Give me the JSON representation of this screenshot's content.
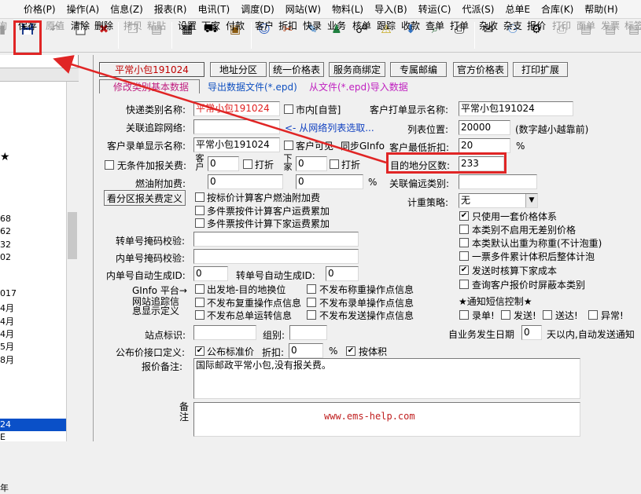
{
  "menu": [
    "价格(P)",
    "操作(A)",
    "信息(Z)",
    "报表(R)",
    "电讯(T)",
    "调度(D)",
    "网站(W)",
    "物料(L)",
    "导入(B)",
    "转运(C)",
    "代派(S)",
    "总单E",
    "合库(K)",
    "帮助(H)"
  ],
  "toolbar": {
    "left_fragment": "询",
    "save": "保存",
    "original": "原值",
    "clear": "清除",
    "delete": "删除",
    "copy": "拷贝",
    "paste": "粘贴",
    "settings": "设置",
    "download": "下家",
    "pay": "付款",
    "customer": "客户",
    "discount": "折扣",
    "express": "快录",
    "business": "业务",
    "check": "核单",
    "track": "跟踪",
    "receive": "收款",
    "query": "查单",
    "print_bill": "打单",
    "misc_receive": "杂收",
    "misc_pay": "杂支",
    "quote": "报价",
    "print": "打印",
    "face_bill": "面单",
    "invoice": "发票",
    "label": "标签"
  },
  "left_pane": {
    "fragments": [
      "★",
      "68",
      "62",
      "32",
      "02",
      "017",
      "4月",
      "4月",
      "4月",
      "5月",
      "8月",
      "24",
      "E",
      "年"
    ]
  },
  "tabs": {
    "t1": "平常小包191024",
    "t2": "地址分区",
    "t3": "统一价格表",
    "t4": "服务商绑定",
    "t5": "专属邮编",
    "t6": "官方价格表",
    "t7": "打印扩展"
  },
  "subtabs": {
    "edit": "修改类别基本数据",
    "export": "导出数据文件(*.epd)",
    "import": "从文件(*.epd)导入数据"
  },
  "form": {
    "type_name_label": "快递类别名称:",
    "type_name": "平常小包191024",
    "city_label": "市内[自营]",
    "bill_name_label": "客户打单显示名称:",
    "bill_name": "平常小包191024",
    "track_net_label": "关联追踪网络:",
    "track_hint": "<- 从网络列表选取...",
    "list_pos_label": "列表位置:",
    "list_pos": "20000",
    "list_pos_hint": "(数字越小越靠前)",
    "entry_name_label": "客户录单显示名称:",
    "entry_name": "平常小包191024",
    "cust_visible_label": "客户可见",
    "sync_label": "同步GInfo",
    "min_discount_label": "客户最低折扣:",
    "min_discount": "20",
    "pct": "%",
    "no_cond_label": "无条件加报关费:",
    "cust_v": "客户",
    "disc1": "打折",
    "val0a": "0",
    "down_v": "下家",
    "val0b": "0",
    "disc2": "打折",
    "zone_count_label": "目的地分区数:",
    "zone_count": "233",
    "fuel_label": "燃油附加费:",
    "fuel_a": "0",
    "fuel_b": "0",
    "remote_label": "关联偏远类别:",
    "view_zone_btn": "看分区报关费定义",
    "cb_fuel_std": "按标价计算客户燃油附加费",
    "cb_multi_cust": "多件票按件计算客户运费累加",
    "cb_multi_down": "多件票按件计算下家运费累加",
    "strategy_label": "计重策略:",
    "strategy": "无",
    "only_one": "只使用一套价格体系",
    "no_diff": "本类别不启用无差别价格",
    "default_weight": "本类默认出重为称重(不计泡重)",
    "multi_weight": "一票多件累计体积后整体计泡",
    "check_cost": "发送时核算下家成本",
    "hide_type": "查询客户报价时屏蔽本类别",
    "transfer_check_label": "转单号掩码校验:",
    "inner_check_label": "内单号掩码校验:",
    "inner_auto_label": "内单号自动生成ID:",
    "inner_auto": "0",
    "transfer_auto_label": "转单号自动生成ID:",
    "transfer_auto": "0",
    "ginfo_label": "GInfo 平台→",
    "web_track_label": "网站追踪信",
    "info_def_label": "息显示定义",
    "cb_a": "出发地-目的地换位",
    "cb_b": "不发布称重操作点信息",
    "cb_c": "不发布复重操作点信息",
    "cb_d": "不发布录单操作点信息",
    "cb_e": "不发布总单运转信息",
    "cb_f": "不发布发送操作点信息",
    "sms_label": "★通知短信控制★",
    "sms_entry": "录单!",
    "sms_send": "发送!",
    "sms_arrive": "送达!",
    "sms_abnormal": "异常!",
    "station_label": "站点标识:",
    "group_label": "组别:",
    "self_date_label": "自业务发生日期",
    "self_date_val": "0",
    "self_date_hint": "天以内,自动发送通知",
    "pub_label": "公布价接口定义:",
    "pub_std": "公布标准价",
    "pub_disc_label": "折扣:",
    "pub_disc": "0",
    "pub_pct": "%",
    "by_volume": "按体积",
    "note_label": "报价备注:",
    "note": "国际邮政平常小包,没有报关费。",
    "remark_label": "备注",
    "watermark": "www.ems-help.com"
  }
}
